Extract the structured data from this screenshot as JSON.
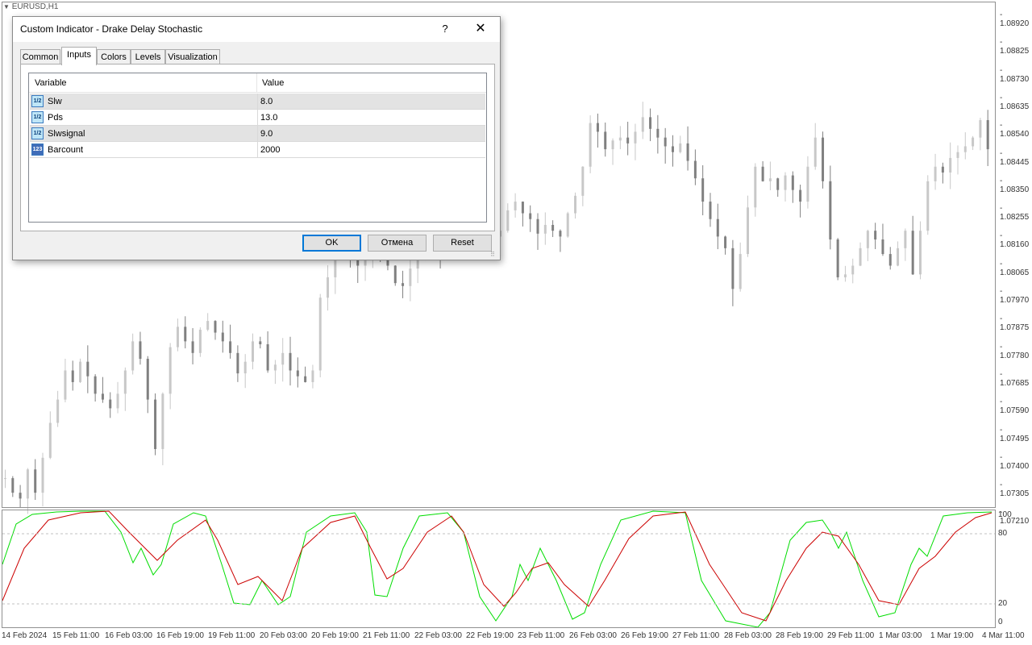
{
  "chart": {
    "symbol": "EURUSD,H1",
    "price_ticks": [
      "1.08920",
      "1.08825",
      "1.08730",
      "1.08635",
      "1.08540",
      "1.08445",
      "1.08350",
      "1.08255",
      "1.08160",
      "1.08065",
      "1.07970",
      "1.07875",
      "1.07780",
      "1.07685",
      "1.07590",
      "1.07495",
      "1.07400",
      "1.07305",
      "1.07210"
    ],
    "indicator_levels": [
      "100",
      "80",
      "20",
      "0"
    ],
    "time_labels": [
      "14 Feb 2024",
      "15 Feb 11:00",
      "16 Feb 03:00",
      "16 Feb 19:00",
      "19 Feb 11:00",
      "20 Feb 03:00",
      "20 Feb 19:00",
      "21 Feb 11:00",
      "22 Feb 03:00",
      "22 Feb 19:00",
      "23 Feb 11:00",
      "26 Feb 03:00",
      "26 Feb 19:00",
      "27 Feb 11:00",
      "28 Feb 03:00",
      "28 Feb 19:00",
      "29 Feb 11:00",
      "1 Mar 03:00",
      "1 Mar 19:00",
      "4 Mar 11:00"
    ],
    "colors": {
      "main_line": "#00dd00",
      "signal_line": "#cc0000",
      "candle_up": "#c8c8c8",
      "candle_down": "#808080",
      "grid": "#c0c0c0"
    },
    "price_series": [
      1.0733,
      1.0728,
      1.0726,
      1.0736,
      1.0728,
      1.074,
      1.0752,
      1.076,
      1.077,
      1.0766,
      1.0773,
      1.0768,
      1.0762,
      1.076,
      1.0757,
      1.0762,
      1.077,
      1.078,
      1.0774,
      1.076,
      1.0743,
      1.0762,
      1.0778,
      1.0785,
      1.078,
      1.0776,
      1.0784,
      1.0787,
      1.0783,
      1.078,
      1.0776,
      1.0769,
      1.0773,
      1.078,
      1.0779,
      1.077,
      1.0772,
      1.0776,
      1.077,
      1.0768,
      1.0766,
      1.077,
      1.0795,
      1.0802,
      1.0812,
      1.0814,
      1.0808,
      1.0806,
      1.0808,
      1.0815,
      1.0812,
      1.0806,
      1.08,
      1.0799,
      1.0805,
      1.0808,
      1.0812,
      1.0815,
      1.081,
      1.0815,
      1.0818,
      1.0821,
      1.0828,
      1.0825,
      1.082,
      1.0816,
      1.0818,
      1.0825,
      1.0828,
      1.0824,
      1.0822,
      1.0817,
      1.082,
      1.0818,
      1.0816,
      1.0824,
      1.083,
      1.084,
      1.0855,
      1.0852,
      1.0846,
      1.0849,
      1.085,
      1.0848,
      1.0852,
      1.0857,
      1.0853,
      1.085,
      1.0847,
      1.0845,
      1.0848,
      1.0842,
      1.0836,
      1.0828,
      1.0822,
      1.0816,
      1.0812,
      1.0798,
      1.081,
      1.0826,
      1.084,
      1.0835,
      1.0836,
      1.0832,
      1.0837,
      1.0832,
      1.0828,
      1.084,
      1.085,
      1.0835,
      1.0815,
      1.0802,
      1.0803,
      1.0806,
      1.0812,
      1.0818,
      1.0815,
      1.081,
      1.0806,
      1.0812,
      1.0818,
      1.0803,
      1.0818,
      1.0835,
      1.084,
      1.0838,
      1.0843,
      1.0845,
      1.0847,
      1.085,
      1.0856,
      1.0846
    ]
  },
  "dialog": {
    "title": "Custom Indicator - Drake Delay Stochastic",
    "help_glyph": "?",
    "close_glyph": "✕",
    "tabs": [
      "Common",
      "Inputs",
      "Colors",
      "Levels",
      "Visualization"
    ],
    "active_tab": "Inputs",
    "table": {
      "headers": [
        "Variable",
        "Value"
      ],
      "rows": [
        {
          "icon": "fraction-icon",
          "icon_text": "1/2",
          "variable": "Slw",
          "value": "8.0"
        },
        {
          "icon": "fraction-icon",
          "icon_text": "1/2",
          "variable": "Pds",
          "value": "13.0"
        },
        {
          "icon": "fraction-icon",
          "icon_text": "1/2",
          "variable": "Slwsignal",
          "value": "9.0"
        },
        {
          "icon": "integer-icon",
          "icon_text": "123",
          "variable": "Barcount",
          "value": "2000"
        }
      ]
    },
    "buttons": {
      "ok": "OK",
      "cancel": "Отмена",
      "reset": "Reset"
    }
  }
}
